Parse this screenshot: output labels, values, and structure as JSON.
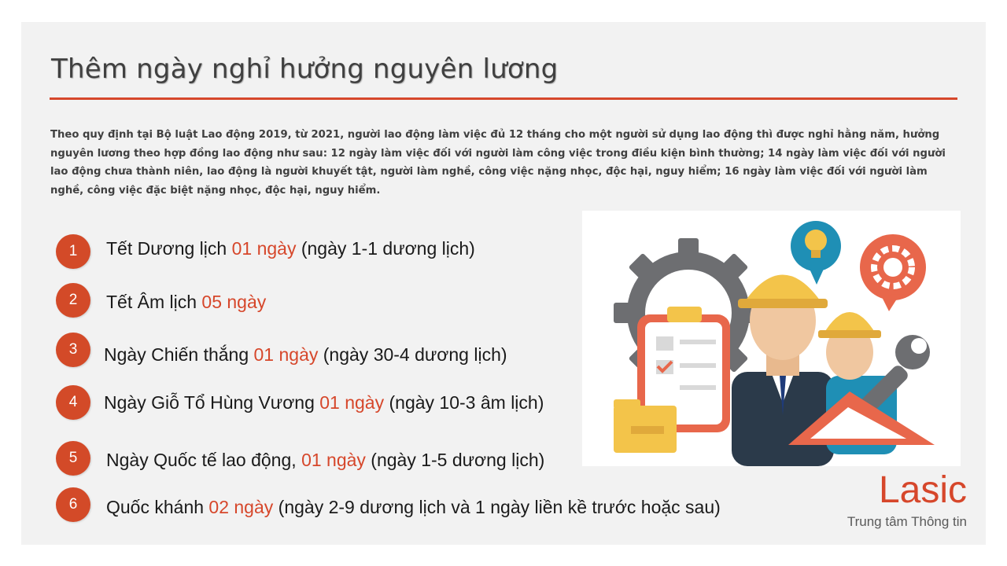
{
  "title": "Thêm ngày nghỉ hưởng nguyên lương",
  "intro": "Theo quy định tại Bộ luật Lao động 2019, từ 2021, người lao động làm việc đủ 12 tháng cho một người sử dụng lao động thì được nghỉ hằng năm, hưởng nguyên lương theo hợp đồng lao động như sau: 12 ngày làm việc đối với người làm công việc trong điều kiện bình thường; 14 ngày làm việc đối với người lao động chưa thành niên, lao động là người khuyết tật, người làm nghề, công việc nặng nhọc, độc hại, nguy hiểm; 16 ngày làm việc đối với người làm nghề, công việc đặc biệt nặng nhọc, độc hại, nguy hiểm.",
  "items": [
    {
      "num": "1",
      "label": "Tết Dương lịch ",
      "days": "01 ngày",
      "note": " (ngày 1-1 dương lịch)"
    },
    {
      "num": "2",
      "label": "Tết Âm lịch ",
      "days": "05 ngày",
      "note": ""
    },
    {
      "num": "3",
      "label": "Ngày Chiến thắng ",
      "days": "01 ngày",
      "note": " (ngày 30-4 dương lịch)"
    },
    {
      "num": "4",
      "label": "Ngày Giỗ Tổ Hùng Vương ",
      "days": "01 ngày",
      "note": " (ngày 10-3 âm lịch)"
    },
    {
      "num": "5",
      "label": "Ngày Quốc tế lao động, ",
      "days": "01 ngày",
      "note": " (ngày 1-5 dương lịch)"
    },
    {
      "num": "6",
      "label": "Quốc khánh ",
      "days": "02 ngày",
      "note": " (ngày 2-9 dương lịch và 1 ngày liền kề trước hoặc sau)"
    }
  ],
  "brand": {
    "name": "Lasic",
    "subtitle": "Trung tâm Thông tin"
  },
  "colors": {
    "accent": "#d6472b",
    "badge": "#d34a28",
    "panel": "#f2f2f2"
  }
}
